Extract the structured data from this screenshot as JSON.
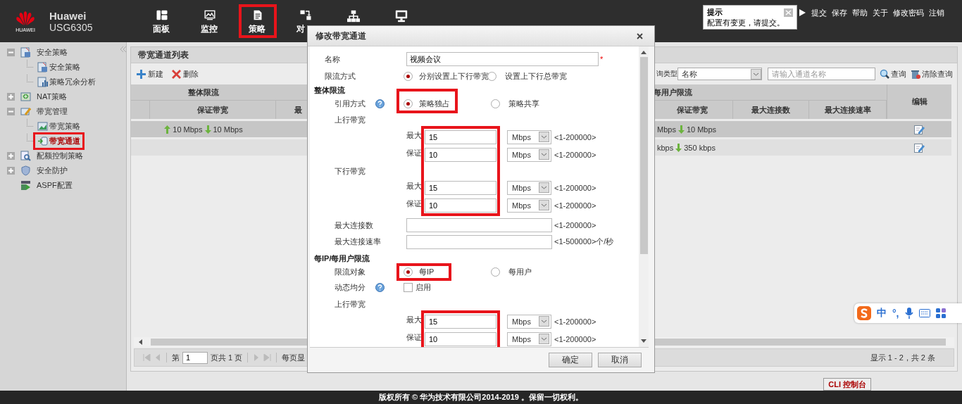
{
  "brand": {
    "company": "Huawei",
    "model": "USG6305",
    "logo_text": "HUAWEI"
  },
  "nav": [
    {
      "kind": "dashboard",
      "label": "面板",
      "selected": false
    },
    {
      "kind": "monitor",
      "label": "监控",
      "selected": false
    },
    {
      "kind": "policy",
      "label": "策略",
      "selected": true
    },
    {
      "kind": "object",
      "label": "对",
      "selected": false
    },
    {
      "kind": "network",
      "selected": false
    },
    {
      "kind": "system",
      "selected": false
    }
  ],
  "notice": {
    "title": "提示",
    "message": "配置有变更，请提交。"
  },
  "top_links": [
    "提交",
    "保存",
    "帮助",
    "关于",
    "修改密码",
    "注销"
  ],
  "sidebar": {
    "items": [
      {
        "kind": "policy",
        "label": "安全策略",
        "expanded": true,
        "selected": false,
        "children": [
          {
            "kind": "policy",
            "label": "安全策略",
            "selected": false
          },
          {
            "kind": "analysis",
            "label": "策略冗余分析",
            "selected": false
          }
        ]
      },
      {
        "kind": "nat",
        "label": "NAT策略",
        "expanded": false,
        "selected": false
      },
      {
        "kind": "bandwidth",
        "label": "带宽管理",
        "expanded": true,
        "selected": false,
        "children": [
          {
            "kind": "chart",
            "label": "带宽策略",
            "selected": false
          },
          {
            "kind": "channel",
            "label": "带宽通道",
            "selected": true
          }
        ]
      },
      {
        "kind": "quota",
        "label": "配额控制策略",
        "expanded": false,
        "selected": false
      },
      {
        "kind": "shield",
        "label": "安全防护",
        "expanded": false,
        "selected": false
      },
      {
        "kind": "aspf",
        "label": "ASPF配置",
        "selected": false
      }
    ]
  },
  "panel": {
    "title": "带宽通道列表",
    "toolbar": [
      {
        "kind": "add",
        "label": "新建"
      },
      {
        "kind": "delete",
        "label": "删除"
      }
    ],
    "query": {
      "type_label": "询类型",
      "type_value": "名称",
      "placeholder": "请输入通道名称",
      "search": "查询",
      "clear": "清除查询"
    },
    "table": {
      "group_left": "整体限流",
      "group_right": "每用户限流",
      "columns_left": [
        "保证带宽",
        "最"
      ],
      "columns_right": [
        "保证带宽",
        "最大连接数",
        "最大连接速率"
      ],
      "edit_column": "编辑",
      "rows": [
        {
          "selected": true,
          "left_up": "10 Mbps",
          "left_down": "10 Mbps",
          "right_up": "Mbps",
          "right_down": "10 Mbps"
        },
        {
          "selected": false,
          "right_up": "kbps",
          "right_down": "350 kbps"
        }
      ]
    },
    "pager": {
      "page_prefix": "第",
      "page": "1",
      "page_suffix": "页共 1 页",
      "per_page": "每页显",
      "summary": "显示 1 - 2，共 2 条"
    }
  },
  "cli_button": "CLI 控制台",
  "dialog": {
    "title": "修改带宽通道",
    "name": {
      "label": "名称",
      "value": "视频会议",
      "required_mark": "*"
    },
    "limit_mode": {
      "label": "限流方式",
      "options": [
        {
          "label": "分别设置上下行带宽",
          "selected": true
        },
        {
          "label": "设置上下行总带宽",
          "selected": false
        }
      ]
    },
    "overall": {
      "title": "整体限流",
      "reference": {
        "label": "引用方式",
        "help": true,
        "highlighted": true,
        "options": [
          {
            "label": "策略独占",
            "selected": true
          },
          {
            "label": "策略共享",
            "selected": false
          }
        ]
      },
      "fields_highlighted": true,
      "directions": [
        {
          "label": "上行带宽",
          "rows": [
            {
              "label": "最大",
              "value": "15",
              "unit": "Mbps",
              "range": "<1-200000>"
            },
            {
              "label": "保证",
              "value": "10",
              "unit": "Mbps",
              "range": "<1-200000>"
            }
          ]
        },
        {
          "label": "下行带宽",
          "rows": [
            {
              "label": "最大",
              "value": "15",
              "unit": "Mbps",
              "range": "<1-200000>"
            },
            {
              "label": "保证",
              "value": "10",
              "unit": "Mbps",
              "range": "<1-200000>"
            }
          ]
        }
      ],
      "max_conn": {
        "label": "最大连接数",
        "range": "<1-200000>"
      },
      "max_rate": {
        "label": "最大连接速率",
        "range": "<1-500000>个/秒"
      }
    },
    "per_ip": {
      "title": "每IP/每用户限流",
      "target": {
        "label": "限流对象",
        "highlighted": true,
        "options": [
          {
            "label": "每IP",
            "selected": true
          },
          {
            "label": "每用户",
            "selected": false
          }
        ]
      },
      "dynamic": {
        "label": "动态均分",
        "help": true,
        "checkbox_label": "启用",
        "checked": false
      },
      "fields_highlighted": true,
      "directions": [
        {
          "label": "上行带宽",
          "rows": [
            {
              "label": "最大",
              "value": "15",
              "unit": "Mbps",
              "range": "<1-200000>"
            },
            {
              "label": "保证",
              "value": "10",
              "unit": "Mbps",
              "range": "<1-200000>"
            }
          ]
        }
      ]
    },
    "buttons": [
      "确定",
      "取消"
    ]
  },
  "ime": {
    "mode": "中",
    "punct": "°,"
  },
  "footer": "版权所有 © 华为技术有限公司2014-2019 。保留一切权利。"
}
